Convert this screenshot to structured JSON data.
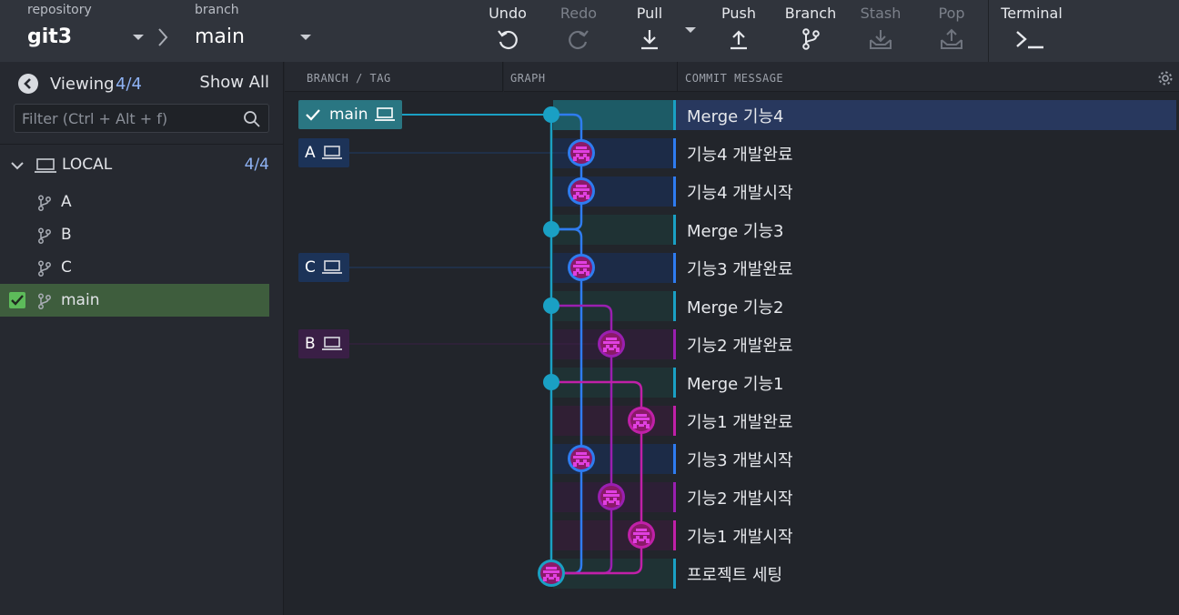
{
  "toolbar": {
    "repository": {
      "caption": "repository",
      "value": "git3"
    },
    "branch": {
      "caption": "branch",
      "value": "main"
    },
    "buttons": {
      "undo": "Undo",
      "redo": "Redo",
      "pull": "Pull",
      "push": "Push",
      "branch": "Branch",
      "stash": "Stash",
      "pop": "Pop",
      "terminal": "Terminal"
    }
  },
  "left_panel": {
    "viewing_label": "Viewing",
    "viewing_count": "4/4",
    "show_all": "Show All",
    "filter_placeholder": "Filter (Ctrl + Alt + f)",
    "local": {
      "label": "LOCAL",
      "count": "4/4",
      "branches": [
        "A",
        "B",
        "C",
        "main"
      ],
      "checked_out": "main"
    }
  },
  "graph": {
    "headers": {
      "branch_tag": "BRANCH / TAG",
      "graph": "GRAPH",
      "commit_message": "COMMIT MESSAGE"
    },
    "tags": [
      {
        "name": "main",
        "color": "#2a7682"
      },
      {
        "name": "A",
        "color": "#1c3358"
      },
      {
        "name": "C",
        "color": "#1c3358"
      },
      {
        "name": "B",
        "color": "#3a1f46"
      }
    ],
    "commits": [
      "Merge 기능4",
      "기능4 개발완료",
      "기능4 개발시작",
      "Merge 기능3",
      "기능3 개발완료",
      "Merge 기능2",
      "기능2 개발완료",
      "Merge 기능1",
      "기능1 개발완료",
      "기능3 개발시작",
      "기능2 개발시작",
      "기능1 개발시작",
      "프로젝트 세팅"
    ],
    "colors": {
      "main": "#1aa0c4",
      "blue": "#2f7cf0",
      "purple": "#9a1fb0",
      "magenta": "#c020a8"
    }
  }
}
